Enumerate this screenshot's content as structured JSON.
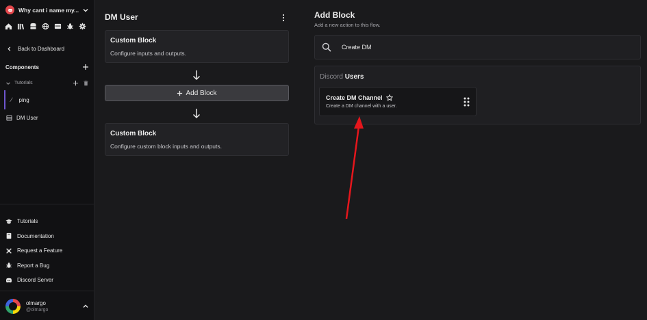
{
  "sidebar": {
    "server_name": "Why cant i name my...",
    "icons": [
      "home-icon",
      "library-icon",
      "database-icon",
      "globe-icon",
      "layout-icon",
      "bug-icon",
      "settings-icon"
    ],
    "back_label": "Back to Dashboard",
    "components_label": "Components",
    "folder_label": "Tutorials",
    "items": [
      {
        "label": "ping",
        "icon": "slash-icon"
      },
      {
        "label": "DM User",
        "icon": "block-icon"
      }
    ],
    "links": [
      {
        "label": "Tutorials",
        "icon": "graduation-cap-icon"
      },
      {
        "label": "Documentation",
        "icon": "book-icon"
      },
      {
        "label": "Request a Feature",
        "icon": "bug-feature-icon"
      },
      {
        "label": "Report a Bug",
        "icon": "bug-icon"
      },
      {
        "label": "Discord Server",
        "icon": "discord-icon"
      }
    ],
    "user": {
      "name": "olmargo",
      "handle": "@olmargo"
    }
  },
  "flow": {
    "title": "DM User",
    "blocks": [
      {
        "title": "Custom Block",
        "description": "Configure inputs and outputs."
      },
      {
        "title": "Custom Block",
        "description": "Configure custom block inputs and outputs."
      }
    ],
    "add_block_label": "Add Block"
  },
  "add_block_panel": {
    "title": "Add Block",
    "subtitle": "Add a new action to this flow.",
    "search_value": "Create DM",
    "category_prefix": "Discord",
    "category_name": "Users",
    "result": {
      "title": "Create DM Channel",
      "description": "Create a DM channel with a user."
    }
  },
  "colors": {
    "accent": "#6e56cf",
    "annotation_arrow": "#e5161c",
    "brand_red": "#e5484d"
  }
}
